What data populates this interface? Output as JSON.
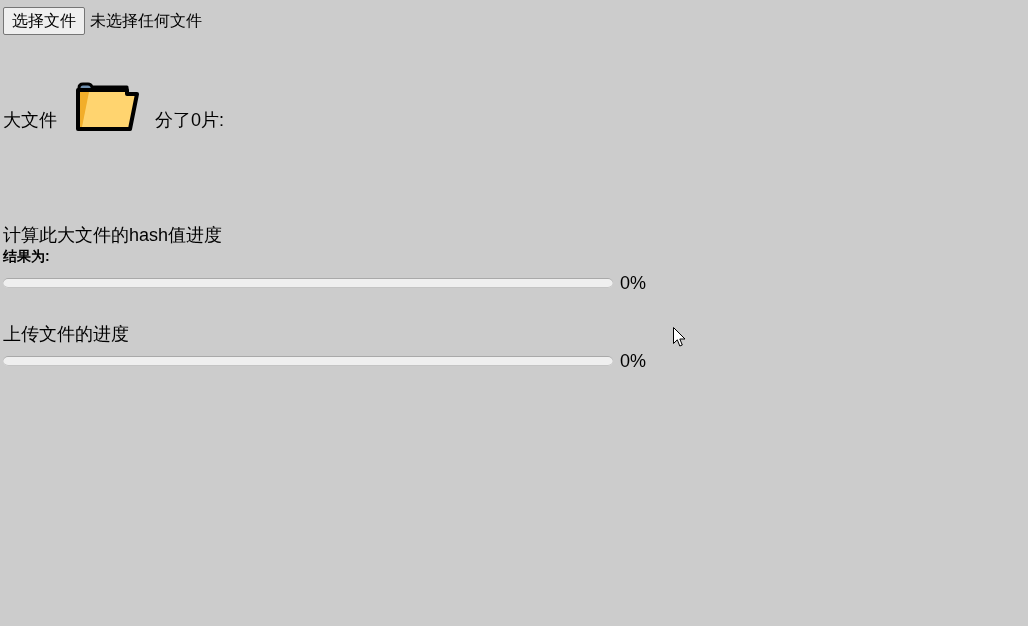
{
  "file_input": {
    "button": "选择文件",
    "status": "未选择任何文件"
  },
  "big_file": {
    "label": "大文件",
    "chunks_text": "分了0片:"
  },
  "hash_progress": {
    "title": "计算此大文件的hash值进度",
    "result_label": "结果为:",
    "level": 0,
    "reading": "0%"
  },
  "upload_progress": {
    "title": "上传文件的进度",
    "level": 0,
    "reading": "0%"
  }
}
